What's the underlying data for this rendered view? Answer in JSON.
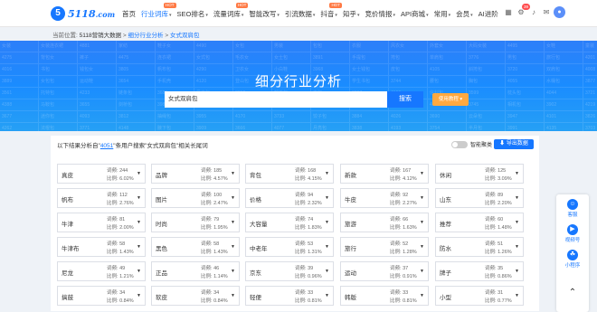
{
  "logo": {
    "mark": "5",
    "text": "5118",
    "suffix": ".com"
  },
  "nav": [
    {
      "label": "首页",
      "caret": false,
      "hot": ""
    },
    {
      "label": "行业词库",
      "caret": true,
      "hot": "HOT"
    },
    {
      "label": "SEO排名",
      "caret": true,
      "hot": ""
    },
    {
      "label": "流量词库",
      "caret": true,
      "hot": "HOT"
    },
    {
      "label": "智能改写",
      "caret": true,
      "hot": ""
    },
    {
      "label": "引流数据",
      "caret": true,
      "hot": ""
    },
    {
      "label": "抖音",
      "caret": true,
      "hot": "HOT"
    },
    {
      "label": "知乎",
      "caret": true,
      "hot": ""
    },
    {
      "label": "竞价情报",
      "caret": true,
      "hot": ""
    },
    {
      "label": "API商城",
      "caret": true,
      "hot": ""
    },
    {
      "label": "常用",
      "caret": true,
      "hot": ""
    },
    {
      "label": "会员",
      "caret": true,
      "hot": ""
    },
    {
      "label": "AI进阶",
      "caret": false,
      "hot": ""
    }
  ],
  "tools": {
    "badge": "39"
  },
  "breadcrumb": {
    "prefix": "当前位置:",
    "items": [
      "5118营销大数据",
      "细分行业分析",
      "女式双肩包"
    ],
    "sep": ">"
  },
  "hero": {
    "title": "细分行业分析",
    "search_value": "女式双肩包",
    "search_button": "搜索",
    "help_button": "使用教程",
    "bg_cells": [
      [
        "女装",
        "女装连衣裙",
        "4881",
        "家纺",
        "鞋子女",
        "4490",
        "女包",
        "男装",
        "包包",
        "衣服",
        "风衣女",
        "外套女",
        "大码女装",
        "4495",
        "女鞋",
        "童装"
      ],
      [
        "4275",
        "背包女",
        "裤子",
        "4475",
        "连衣裙",
        "女式包",
        "毛衣女",
        "女士包",
        "3891",
        "手提包",
        "挎包",
        "单肩包",
        "3776",
        "男包",
        "旅行包",
        "4201"
      ],
      [
        "4016",
        "书包",
        "钱包女",
        "3805",
        "帆布包",
        "4290",
        "卫衣女",
        "小白鞋",
        "3968",
        "女士钱包",
        "皮包",
        "4105",
        "斜挎包",
        "3720",
        "双肩包",
        "4008"
      ],
      [
        "3889",
        "女包包",
        "运动鞋",
        "3654",
        "手机壳",
        "4120",
        "登山包",
        "电脑包",
        "3992",
        "学生书包",
        "3744",
        "腰包",
        "胸包",
        "4055",
        "水桶包",
        "3877"
      ],
      [
        "3561",
        "托特包",
        "4233",
        "链条包",
        "3688",
        "贝壳包",
        "3910",
        "邮差包",
        "方包",
        "3807",
        "4166",
        "信封包",
        "3599",
        "枕头包",
        "4044",
        "3721"
      ],
      [
        "4388",
        "马鞍包",
        "3655",
        "剑桥包",
        "3980",
        "波士顿包",
        "4122",
        "3794",
        "手拿包",
        "3866",
        "晚宴包",
        "4011",
        "3745",
        "相机包",
        "3902",
        "4219"
      ],
      [
        "3677",
        "迷你包",
        "4093",
        "3812",
        "抽绳包",
        "3955",
        "4170",
        "3733",
        "饺子包",
        "3884",
        "4026",
        "3690",
        "云朵包",
        "3947",
        "4101",
        "3826"
      ],
      [
        "4262",
        "法棍包",
        "3771",
        "4148",
        "腋下包",
        "3909",
        "3666",
        "4077",
        "月亮包",
        "3838",
        "4193",
        "3754",
        "半月包",
        "3991",
        "4135",
        "3703"
      ]
    ]
  },
  "summary": {
    "pre": "以下结果分析自\"",
    "count": "4051",
    "post": "\"条用户搜索\"女式双肩包\"相关长尾词"
  },
  "toggle_label": "智能聚类",
  "export_button": "导出数据",
  "cards": [
    {
      "kw": "真皮",
      "hits": "244",
      "ratio": "6.02%"
    },
    {
      "kw": "品牌",
      "hits": "185",
      "ratio": "4.57%"
    },
    {
      "kw": "背包",
      "hits": "168",
      "ratio": "4.15%"
    },
    {
      "kw": "新款",
      "hits": "167",
      "ratio": "4.12%"
    },
    {
      "kw": "休闲",
      "hits": "125",
      "ratio": "3.09%"
    },
    {
      "kw": "帆布",
      "hits": "112",
      "ratio": "2.76%"
    },
    {
      "kw": "图片",
      "hits": "100",
      "ratio": "2.47%"
    },
    {
      "kw": "价格",
      "hits": "94",
      "ratio": "2.32%"
    },
    {
      "kw": "牛皮",
      "hits": "92",
      "ratio": "2.27%"
    },
    {
      "kw": "山东",
      "hits": "89",
      "ratio": "2.20%"
    },
    {
      "kw": "牛津",
      "hits": "81",
      "ratio": "2.00%"
    },
    {
      "kw": "时尚",
      "hits": "79",
      "ratio": "1.95%"
    },
    {
      "kw": "大容量",
      "hits": "74",
      "ratio": "1.83%"
    },
    {
      "kw": "旅游",
      "hits": "66",
      "ratio": "1.63%"
    },
    {
      "kw": "推荐",
      "hits": "60",
      "ratio": "1.48%"
    },
    {
      "kw": "牛津布",
      "hits": "58",
      "ratio": "1.43%"
    },
    {
      "kw": "黑色",
      "hits": "58",
      "ratio": "1.43%"
    },
    {
      "kw": "中老年",
      "hits": "53",
      "ratio": "1.31%"
    },
    {
      "kw": "旅行",
      "hits": "52",
      "ratio": "1.28%"
    },
    {
      "kw": "防水",
      "hits": "51",
      "ratio": "1.26%"
    },
    {
      "kw": "尼龙",
      "hits": "49",
      "ratio": "1.21%"
    },
    {
      "kw": "正品",
      "hits": "46",
      "ratio": "1.14%"
    },
    {
      "kw": "京东",
      "hits": "39",
      "ratio": "0.96%"
    },
    {
      "kw": "运动",
      "hits": "37",
      "ratio": "0.91%"
    },
    {
      "kw": "牌子",
      "hits": "35",
      "ratio": "0.86%"
    },
    {
      "kw": "搞鼓",
      "hits": "34",
      "ratio": "0.84%"
    },
    {
      "kw": "软皮",
      "hits": "34",
      "ratio": "0.84%"
    },
    {
      "kw": "轻便",
      "hits": "33",
      "ratio": "0.81%"
    },
    {
      "kw": "韩版",
      "hits": "33",
      "ratio": "0.81%"
    },
    {
      "kw": "小型",
      "hits": "31",
      "ratio": "0.77%"
    }
  ],
  "card_labels": {
    "hits": "词频:",
    "ratio": "比例:"
  },
  "float_bar": [
    {
      "icon": "☺",
      "label": "客服"
    },
    {
      "icon": "▶",
      "label": "视频号"
    },
    {
      "icon": "☘",
      "label": "小程序"
    }
  ],
  "colors": {
    "brand": "#1677ff",
    "hot": "#ff7a45",
    "help": "#ffa940"
  }
}
